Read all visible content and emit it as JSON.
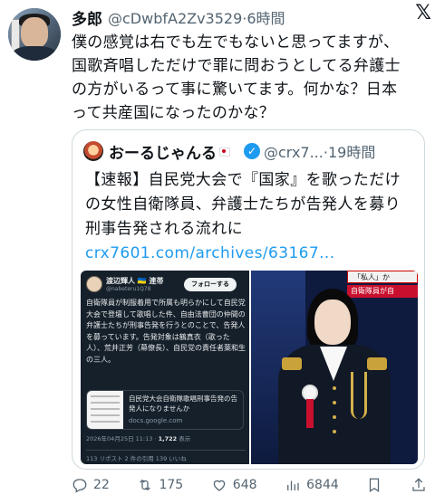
{
  "author": {
    "name": "多郎",
    "handle": "@cDwbfA2Zv3529",
    "time": "6時間"
  },
  "tweet": {
    "text_lines": [
      "僕の感覚は右でも左でもないと思ってますが、",
      "国歌斉唱しただけで罪に問おうとしてる弁護士",
      "の方がいるって事に驚いてます。何かな？日本",
      "って共産国になったのかな？"
    ]
  },
  "quote": {
    "name": "おーるじゃんる",
    "handle": "@crx7...",
    "time": "19時間",
    "text_lines": [
      "【速報】自民党大会で『国家』を歌っただけ",
      "の女性自衛隊員、弁護士たちが告発人を募り",
      "刑事告発される流れに"
    ],
    "link": "crx7601.com/archives/63167..."
  },
  "embedded_post": {
    "name": "渡辺輝人 🇺🇦 連帯",
    "handle": "@nabeteru1Q78",
    "follow_label": "フォローする",
    "text": "自衛隊員が制服着用で所属も明らかにして自民党大会で登壇して歌唱した件、自由法曹団の仲間の弁護士たちが刑事告発を行うとのことで、告発人を募っています。告発対象は鶴真衣（歌った人）、荒井正芳（幕僚長）、自民党の責任者葉和生の三人。",
    "card_title": "自民党大会自衛隊歌唱刑事告発の告発人になりませんか",
    "card_url": "docs.google.com",
    "date": "2026年04月25日 11:13 · ",
    "views": "1,722",
    "views_label": " 表示",
    "stats": "113 リポスト  2 件の引用  139 いいね"
  },
  "photo": {
    "banner_top": "「私人」か",
    "banner_bottom": "自衛隊員が自"
  },
  "actions": {
    "replies": "22",
    "reposts": "175",
    "likes": "648",
    "views": "6844"
  }
}
